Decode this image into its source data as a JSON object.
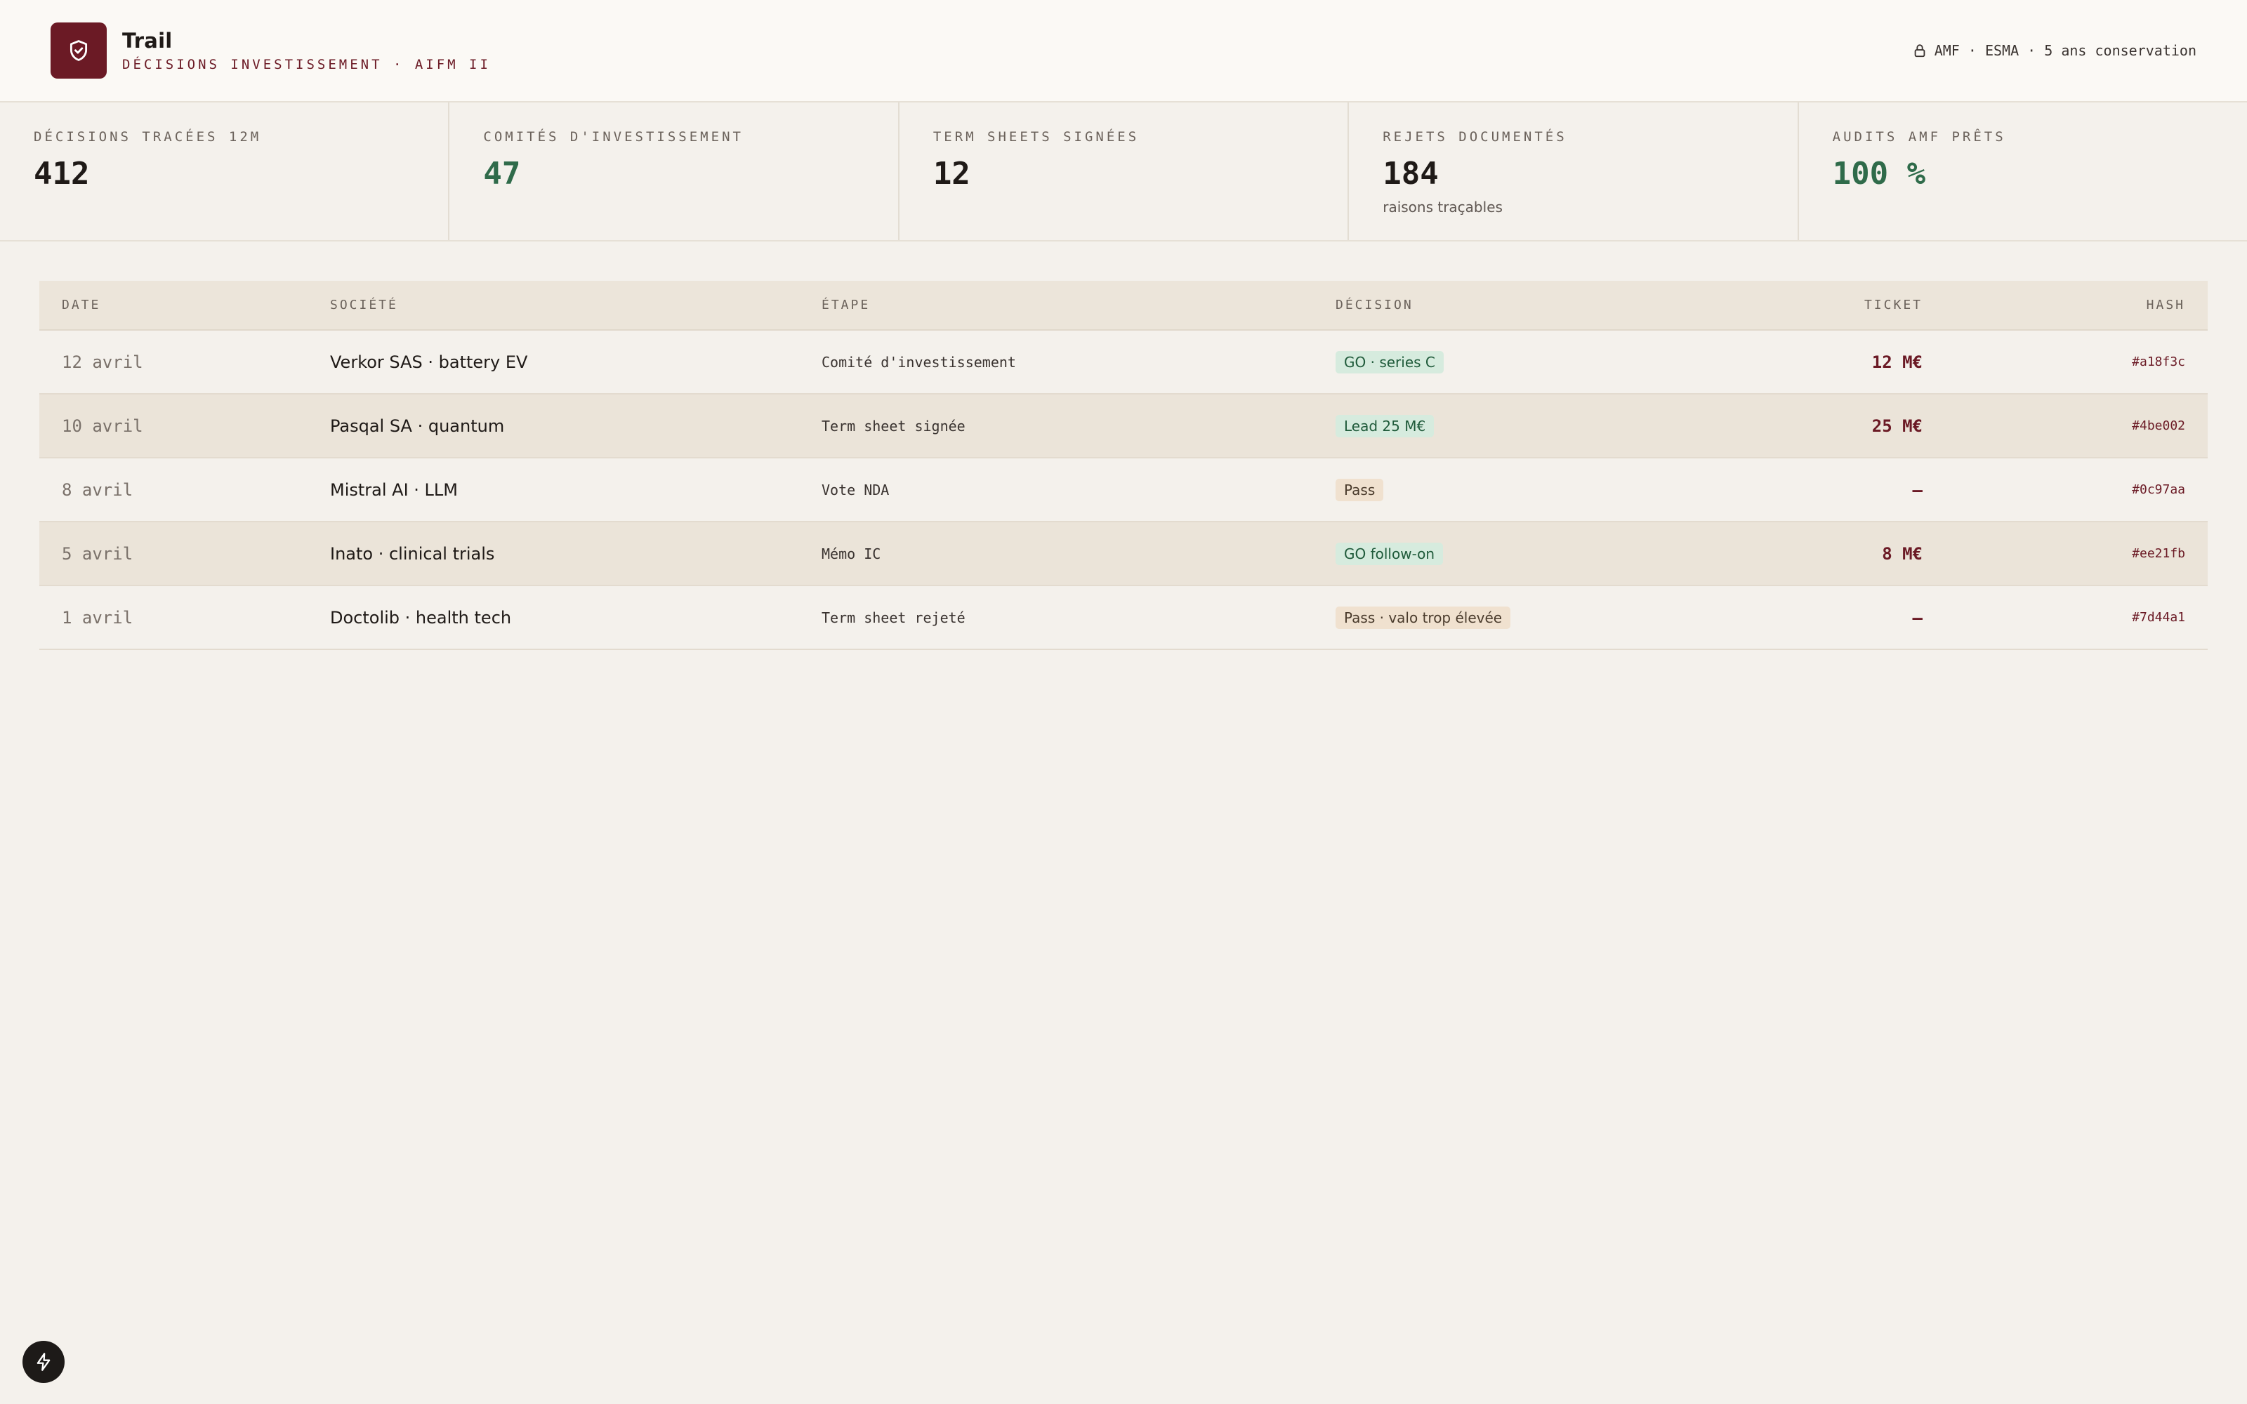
{
  "header": {
    "title": "Trail",
    "subtitle": "DÉCISIONS INVESTISSEMENT · AIFM II",
    "compliance": "AMF · ESMA · 5 ans conservation"
  },
  "kpis": [
    {
      "label": "DÉCISIONS TRACÉES 12M",
      "value": "412",
      "note": ""
    },
    {
      "label": "COMITÉS D'INVESTISSEMENT",
      "value": "47",
      "note": ""
    },
    {
      "label": "TERM SHEETS SIGNÉES",
      "value": "12",
      "note": ""
    },
    {
      "label": "REJETS DOCUMENTÉS",
      "value": "184",
      "note": "raisons traçables"
    },
    {
      "label": "AUDITS AMF PRÊTS",
      "value": "100 %",
      "note": ""
    }
  ],
  "table": {
    "columns": [
      "DATE",
      "SOCIÉTÉ",
      "ÉTAPE",
      "DÉCISION",
      "TICKET",
      "HASH"
    ],
    "rows": [
      {
        "date": "12 avril",
        "company": "Verkor SAS · battery EV",
        "stage": "Comité d'investissement",
        "decision": "GO · series C",
        "ticket": "12 M€",
        "hash": "#a18f3c"
      },
      {
        "date": "10 avril",
        "company": "Pasqal SA · quantum",
        "stage": "Term sheet signée",
        "decision": "Lead 25 M€",
        "ticket": "25 M€",
        "hash": "#4be002"
      },
      {
        "date": "8 avril",
        "company": "Mistral AI · LLM",
        "stage": "Vote NDA",
        "decision": "Pass",
        "ticket": "—",
        "hash": "#0c97aa"
      },
      {
        "date": "5 avril",
        "company": "Inato · clinical trials",
        "stage": "Mémo IC",
        "decision": "GO follow-on",
        "ticket": "8 M€",
        "hash": "#ee21fb"
      },
      {
        "date": "1 avril",
        "company": "Doctolib · health tech",
        "stage": "Term sheet rejeté",
        "decision": "Pass · valo trop élevée",
        "ticket": "—",
        "hash": "#7d44a1"
      }
    ]
  },
  "icons": {
    "logo": "shield-check-icon",
    "compliance": "lock-icon",
    "fab": "bolt-icon"
  },
  "colors": {
    "brand": "#6b1a25",
    "positive": "#2f6b4a",
    "go_badge_bg": "#d6ebde",
    "pass_badge_bg": "#f0e1cf"
  }
}
